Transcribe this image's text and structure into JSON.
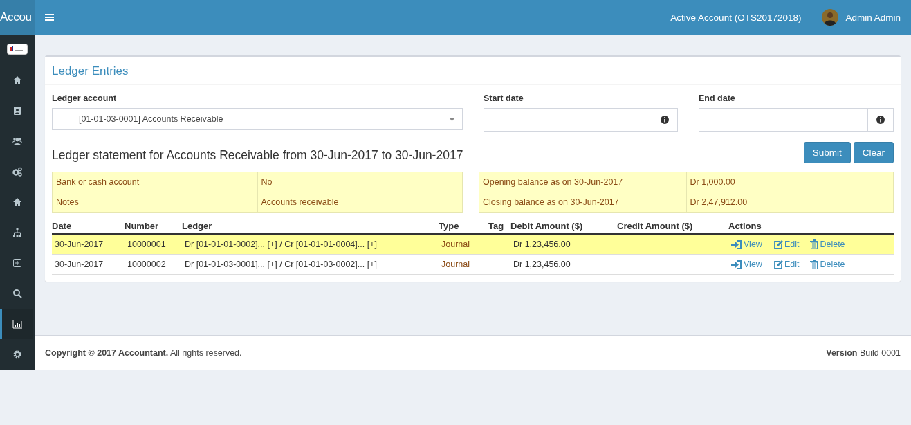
{
  "header": {
    "brand": "Accou",
    "account": "Active Account (OTS20172018)",
    "user": "Admin Admin"
  },
  "sidebar": {
    "items": [
      {
        "kind": "home",
        "selected": false
      },
      {
        "kind": "contacts",
        "selected": false
      },
      {
        "kind": "users",
        "selected": false
      },
      {
        "kind": "gears",
        "selected": false
      },
      {
        "kind": "home",
        "selected": false
      },
      {
        "kind": "sitemap",
        "selected": false
      },
      {
        "kind": "plus",
        "selected": false
      },
      {
        "kind": "search",
        "selected": false
      },
      {
        "kind": "chart",
        "selected": true
      },
      {
        "kind": "gear",
        "selected": false
      }
    ]
  },
  "panel": {
    "title": "Ledger Entries",
    "filters": {
      "ledger_label": "Ledger account",
      "ledger_value": "[01-01-03-0001] Accounts Receivable",
      "start_label": "Start date",
      "end_label": "End date"
    },
    "buttons": [
      "Submit",
      "Clear"
    ],
    "statement_title": "Ledger statement for Accounts Receivable from 30-Jun-2017 to 30-Jun-2017",
    "summary_left": [
      [
        "Bank or cash account",
        "No"
      ],
      [
        "Notes",
        "Accounts receivable"
      ]
    ],
    "summary_right": [
      [
        "Opening balance as on 30-Jun-2017",
        "Dr 1,000.00"
      ],
      [
        "Closing balance as on 30-Jun-2017",
        "Dr 2,47,912.00"
      ]
    ],
    "table": {
      "columns": [
        "Date",
        "Number",
        "Ledger",
        "Type",
        "Tag",
        "Debit Amount ($)",
        "Credit Amount ($)",
        "Actions"
      ],
      "rows": [
        {
          "date": "30-Jun-2017",
          "number": "10000001",
          "ledger": "Dr [01-01-01-0002]... [+] / Cr [01-01-01-0004]... [+]",
          "type": "Journal",
          "debit": "Dr 1,23,456.00",
          "highlighted": true,
          "actions": [
            "View",
            "Edit",
            "Delete"
          ]
        },
        {
          "date": "30-Jun-2017",
          "number": "10000002",
          "ledger": "Dr [01-01-03-0001]... [+] / Cr [01-01-03-0002]... [+]",
          "type": "Journal",
          "debit": "Dr 1,23,456.00",
          "highlighted": false,
          "actions": [
            "View",
            "Edit",
            "Delete"
          ]
        }
      ]
    }
  },
  "footer": {
    "copyright": "**Copyright © 2017 Accountant.** All rights reserved.",
    "version": "**Version** Build 0001"
  }
}
